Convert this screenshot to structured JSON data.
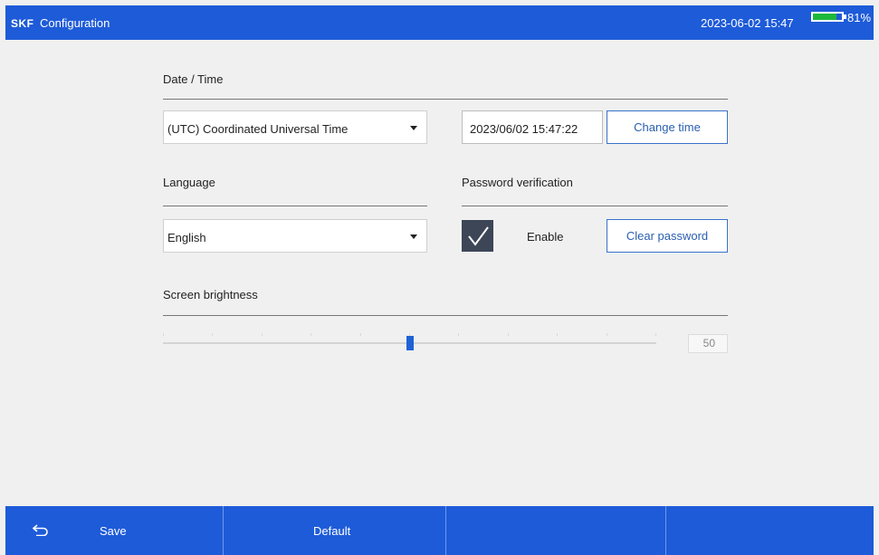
{
  "header": {
    "logo_text": "SKF",
    "title": "Configuration",
    "datetime": "2023-06-02 15:47",
    "battery_percent_label": "81%",
    "battery_level": 0.81,
    "battery_color": "#1cb83c",
    "accent_color": "#1e5bd8"
  },
  "date_time": {
    "label": "Date / Time",
    "timezone_value": "(UTC) Coordinated Universal Time",
    "time_value": "2023/06/02 15:47:22",
    "change_time_label": "Change time"
  },
  "language": {
    "label": "Language",
    "value": "English"
  },
  "password": {
    "label": "Password verification",
    "enable_label": "Enable",
    "enabled": true,
    "clear_label": "Clear password"
  },
  "brightness": {
    "label": "Screen brightness",
    "value": "50",
    "level": 0.5,
    "tick_count": 11
  },
  "footer": {
    "save_label": "Save",
    "default_label": "Default",
    "back_icon": "return-arrow-icon"
  }
}
